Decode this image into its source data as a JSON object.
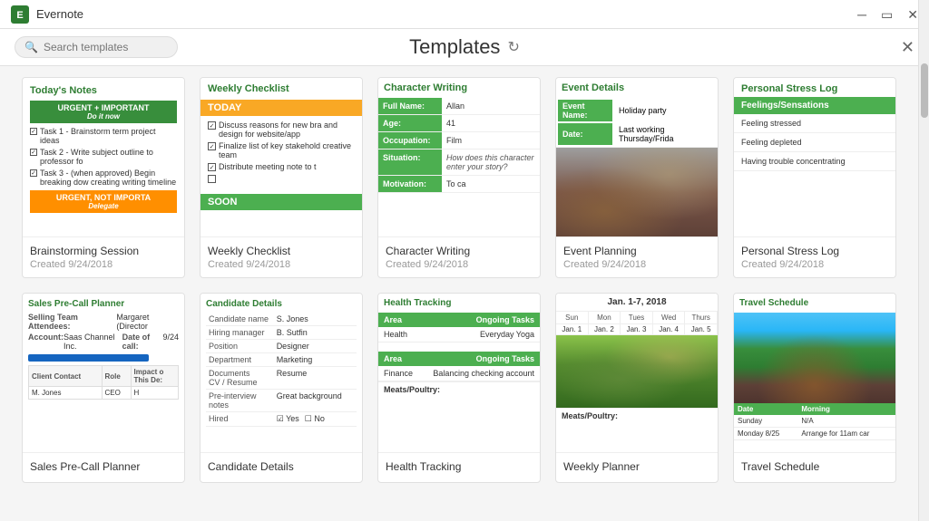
{
  "app": {
    "name": "Evernote",
    "window_controls": [
      "minimize",
      "maximize",
      "close"
    ]
  },
  "header": {
    "search_placeholder": "Search templates",
    "title": "Templates",
    "refresh_icon": "↻",
    "close_label": "✕"
  },
  "templates": [
    {
      "id": "brainstorming",
      "name": "Brainstorming Session",
      "date": "Created 9/24/2018",
      "preview_title": "Today's Notes",
      "type": "brainstorm"
    },
    {
      "id": "weekly-checklist",
      "name": "Weekly Checklist",
      "date": "Created 9/24/2018",
      "preview_title": "Weekly Checklist",
      "type": "weekly"
    },
    {
      "id": "character-writing",
      "name": "Character Writing",
      "date": "Created 9/24/2018",
      "preview_title": "Character Writing",
      "type": "character"
    },
    {
      "id": "event-planning",
      "name": "Event Planning",
      "date": "Created 9/24/2018",
      "preview_title": "Event Details",
      "type": "event"
    },
    {
      "id": "personal-stress",
      "name": "Personal Stress Log",
      "date": "Created 9/24/2018",
      "preview_title": "Personal Stress Log",
      "type": "stress"
    },
    {
      "id": "sales-pre-call",
      "name": "Sales Pre-Call Planner",
      "date": "",
      "preview_title": "Sales Pre-Call Planner",
      "type": "sales"
    },
    {
      "id": "candidate-details",
      "name": "Candidate Details",
      "date": "",
      "preview_title": "Candidate Details",
      "type": "candidate"
    },
    {
      "id": "health-tracking",
      "name": "Health Tracking",
      "date": "",
      "preview_title": "Health Tracking",
      "type": "health"
    },
    {
      "id": "weekly-planner",
      "name": "Weekly Planner",
      "date": "",
      "preview_title": "Jan. 1-7, 2018",
      "type": "planner"
    },
    {
      "id": "travel-schedule",
      "name": "Travel Schedule",
      "date": "",
      "preview_title": "Travel Schedule",
      "type": "travel"
    }
  ],
  "brainstorm": {
    "title": "Today's Notes",
    "urgent_label": "URGENT + IMPORTANT",
    "do_it_now": "Do it now",
    "tasks": [
      "Task 1 - Brainstorm term project ideas",
      "Task 2 - Write subject outline to professor fo",
      "Task 3 - (when approved) Begin breaking dow creating writing timeline"
    ],
    "urgent_not": "URGENT, NOT IMPORTA",
    "delegate": "Delegate"
  },
  "weekly": {
    "title": "Weekly Checklist",
    "today": "TODAY",
    "soon": "SOON",
    "checked_items": [
      "Discuss reasons for new bra and design for website/app",
      "Finalize list of key stakehold creative team",
      "Distribute meeting note to t"
    ]
  },
  "character": {
    "title": "Character Writing",
    "fields": [
      {
        "label": "Full Name:",
        "value": "Allan"
      },
      {
        "label": "Age:",
        "value": "41"
      },
      {
        "label": "Occupation:",
        "value": "Film"
      },
      {
        "label": "Situation:",
        "value_italic": "How does this character enter your story?"
      },
      {
        "label": "Motivation:",
        "value": "To ca"
      }
    ]
  },
  "event": {
    "title": "Event Details",
    "rows": [
      {
        "label": "Event Name:",
        "value": "Holiday party"
      },
      {
        "label": "Date:",
        "value": "Last working Thursday/Frida"
      }
    ]
  },
  "stress": {
    "title": "Personal Stress Log",
    "header": "Feelings/Sensations",
    "items": [
      "Feeling stressed",
      "Feeling depleted",
      "Having trouble concentrating"
    ]
  },
  "sales": {
    "title": "Sales Pre-Call Planner",
    "attendees_label": "Selling Team Attendees:",
    "attendees_value": "Margaret (Director",
    "account_label": "Account:",
    "account_value": "Saas Channel Inc.",
    "date_label": "Date of call:",
    "date_value": "9/24",
    "table_headers": [
      "Client Contact",
      "Role",
      "Impact o This De: This De:"
    ],
    "table_rows": [
      [
        "M. Jones",
        "CEO",
        "H"
      ]
    ]
  },
  "candidate": {
    "title": "Candidate Details",
    "rows": [
      {
        "label": "Candidate name",
        "value": "S. Jones"
      },
      {
        "label": "Hiring manager",
        "value": "B. Sutfin"
      },
      {
        "label": "Position",
        "value": "Designer"
      },
      {
        "label": "Department",
        "value": "Marketing"
      },
      {
        "label": "Documents CV / Resume",
        "value": "Resume"
      },
      {
        "label": "Pre-interview notes",
        "value": "Great background"
      },
      {
        "label": "Hired",
        "value": "yes_no"
      }
    ]
  },
  "health": {
    "title": "Health Tracking",
    "sections": [
      {
        "header_area": "Area",
        "header_tasks": "Ongoing Tasks",
        "rows": [
          {
            "area": "Health",
            "task": "Everyday Yoga"
          }
        ]
      },
      {
        "header_area": "Area",
        "header_tasks": "Ongoing Tasks",
        "rows": [
          {
            "area": "Finance",
            "task": "Balancing checking account"
          }
        ]
      }
    ],
    "meats_label": "Meats/Poultry:"
  },
  "planner": {
    "title": "Jan. 1-7, 2018",
    "days": [
      "Sun",
      "Mon",
      "Tues",
      "Wed",
      "Thurs"
    ],
    "dates": [
      "Jan. 1",
      "Jan. 2",
      "Jan. 3",
      "Jan. 4",
      "Jan. 5"
    ],
    "food_label": "Meats/Poultry:"
  },
  "travel": {
    "title": "Travel Schedule",
    "table_headers": [
      "Date",
      "Morning"
    ],
    "rows": [
      {
        "date": "Sunday",
        "morning": "N/A"
      },
      {
        "date": "Monday 8/25",
        "morning": "Arrange for 11am car"
      }
    ]
  }
}
